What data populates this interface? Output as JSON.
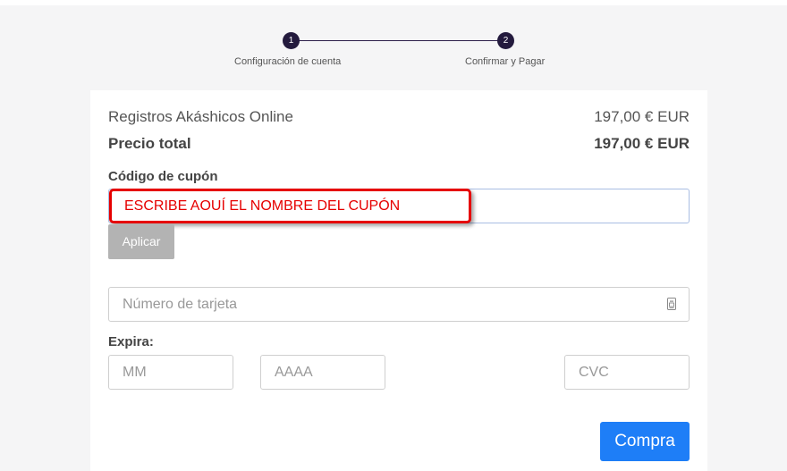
{
  "stepper": {
    "steps": [
      {
        "number": "1",
        "label": "Configuración de cuenta"
      },
      {
        "number": "2",
        "label": "Confirmar y Pagar"
      }
    ]
  },
  "order": {
    "product_name": "Registros Akáshicos Online",
    "product_price": "197,00 € EUR",
    "total_label": "Precio total",
    "total_price": "197,00 € EUR"
  },
  "coupon": {
    "label": "Código de cupón",
    "overlay_text": "ESCRIBE AOUÍ EL NOMBRE DEL CUPÓN",
    "apply_label": "Aplicar"
  },
  "payment": {
    "card_number_placeholder": "Número de tarjeta",
    "expiry_label": "Expira:",
    "mm_placeholder": "MM",
    "yyyy_placeholder": "AAAA",
    "cvc_placeholder": "CVC",
    "card_icon": "credit-card-icon"
  },
  "actions": {
    "buy_label": "Compra"
  },
  "colors": {
    "accent": "#1e7ef7",
    "step_dot": "#231a3d",
    "annotation_red": "#e60000",
    "disabled_button": "#b3b3b3"
  }
}
